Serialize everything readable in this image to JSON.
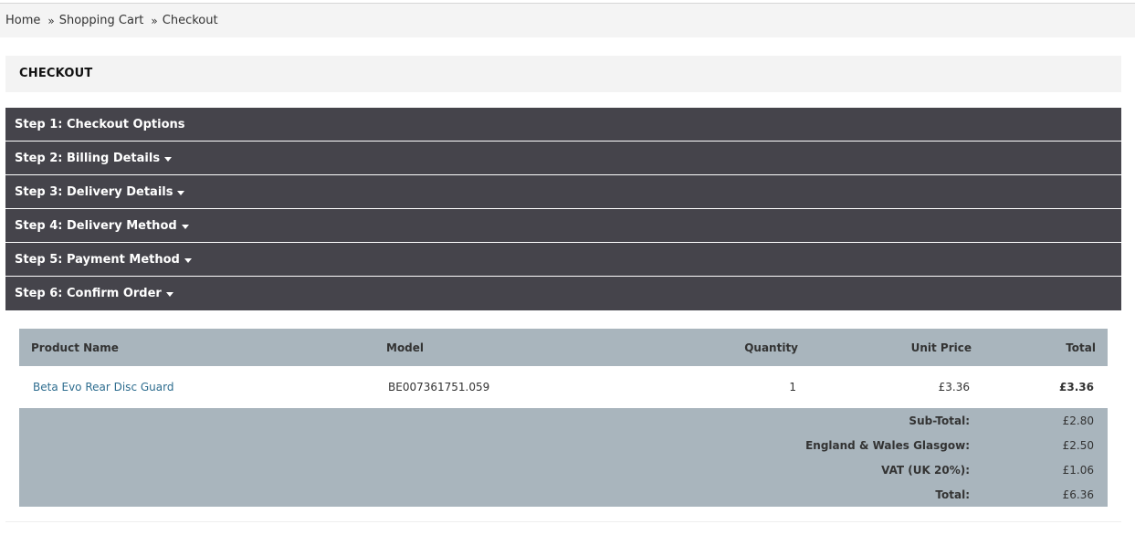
{
  "breadcrumb": {
    "items": [
      "Home",
      "Shopping Cart",
      "Checkout"
    ],
    "separator": "»"
  },
  "page_title": "CHECKOUT",
  "steps": [
    {
      "label": "Step 1: Checkout Options",
      "caret": false
    },
    {
      "label": "Step 2: Billing Details",
      "caret": true
    },
    {
      "label": "Step 3: Delivery Details",
      "caret": true
    },
    {
      "label": "Step 4: Delivery Method",
      "caret": true
    },
    {
      "label": "Step 5: Payment Method",
      "caret": true
    },
    {
      "label": "Step 6: Confirm Order",
      "caret": true
    }
  ],
  "cart": {
    "headers": {
      "product_name": "Product Name",
      "model": "Model",
      "quantity": "Quantity",
      "unit_price": "Unit Price",
      "total": "Total"
    },
    "items": [
      {
        "product_name": "Beta Evo Rear Disc Guard",
        "model": "BE007361751.059",
        "quantity": "1",
        "unit_price": "£3.36",
        "total": "£3.36"
      }
    ],
    "totals": [
      {
        "label": "Sub-Total:",
        "value": "£2.80"
      },
      {
        "label": "England & Wales Glasgow:",
        "value": "£2.50"
      },
      {
        "label": "VAT (UK 20%):",
        "value": "£1.06"
      },
      {
        "label": "Total:",
        "value": "£6.36"
      }
    ]
  },
  "colors": {
    "step_header_bg": "#45444b",
    "table_header_bg": "#a9b5bd",
    "link": "#2e6d8f",
    "breadcrumb_bg": "#f4f4f4"
  }
}
